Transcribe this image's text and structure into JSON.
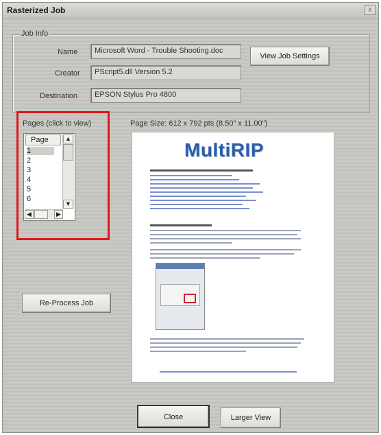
{
  "window": {
    "title": "Rasterized Job",
    "close_glyph": "x"
  },
  "job_info": {
    "group_label": "Job Info",
    "name_label": "Name",
    "name_value": "Microsoft Word - Trouble Shooting.doc",
    "creator_label": "Creator",
    "creator_value": "PScript5.dll Version 5.2",
    "destination_label": "Destination",
    "destination_value": "EPSON Stylus Pro 4800",
    "view_settings_button": "View Job Settings"
  },
  "pages": {
    "group_label": "Pages (click to view)",
    "column_header": "Page",
    "items": [
      "1",
      "2",
      "3",
      "4",
      "5",
      "6"
    ],
    "selected": "1"
  },
  "preview": {
    "page_size": "Page Size: 612 x 792 pts (8.50\" x 11.00\")",
    "logo_text": "MultiRIP"
  },
  "buttons": {
    "reprocess": "Re-Process Job",
    "close": "Close",
    "larger_view": "Larger View"
  },
  "colors": {
    "highlight_box": "#e0151b",
    "logo": "#2c5ea8"
  }
}
